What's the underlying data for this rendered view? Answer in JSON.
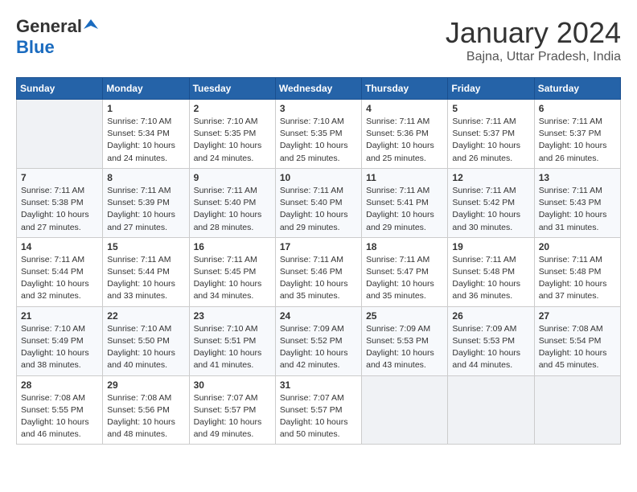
{
  "header": {
    "logo_general": "General",
    "logo_blue": "Blue",
    "month_year": "January 2024",
    "location": "Bajna, Uttar Pradesh, India"
  },
  "calendar": {
    "days_of_week": [
      "Sunday",
      "Monday",
      "Tuesday",
      "Wednesday",
      "Thursday",
      "Friday",
      "Saturday"
    ],
    "weeks": [
      [
        {
          "day": "",
          "info": ""
        },
        {
          "day": "1",
          "info": "Sunrise: 7:10 AM\nSunset: 5:34 PM\nDaylight: 10 hours\nand 24 minutes."
        },
        {
          "day": "2",
          "info": "Sunrise: 7:10 AM\nSunset: 5:35 PM\nDaylight: 10 hours\nand 24 minutes."
        },
        {
          "day": "3",
          "info": "Sunrise: 7:10 AM\nSunset: 5:35 PM\nDaylight: 10 hours\nand 25 minutes."
        },
        {
          "day": "4",
          "info": "Sunrise: 7:11 AM\nSunset: 5:36 PM\nDaylight: 10 hours\nand 25 minutes."
        },
        {
          "day": "5",
          "info": "Sunrise: 7:11 AM\nSunset: 5:37 PM\nDaylight: 10 hours\nand 26 minutes."
        },
        {
          "day": "6",
          "info": "Sunrise: 7:11 AM\nSunset: 5:37 PM\nDaylight: 10 hours\nand 26 minutes."
        }
      ],
      [
        {
          "day": "7",
          "info": "Sunrise: 7:11 AM\nSunset: 5:38 PM\nDaylight: 10 hours\nand 27 minutes."
        },
        {
          "day": "8",
          "info": "Sunrise: 7:11 AM\nSunset: 5:39 PM\nDaylight: 10 hours\nand 27 minutes."
        },
        {
          "day": "9",
          "info": "Sunrise: 7:11 AM\nSunset: 5:40 PM\nDaylight: 10 hours\nand 28 minutes."
        },
        {
          "day": "10",
          "info": "Sunrise: 7:11 AM\nSunset: 5:40 PM\nDaylight: 10 hours\nand 29 minutes."
        },
        {
          "day": "11",
          "info": "Sunrise: 7:11 AM\nSunset: 5:41 PM\nDaylight: 10 hours\nand 29 minutes."
        },
        {
          "day": "12",
          "info": "Sunrise: 7:11 AM\nSunset: 5:42 PM\nDaylight: 10 hours\nand 30 minutes."
        },
        {
          "day": "13",
          "info": "Sunrise: 7:11 AM\nSunset: 5:43 PM\nDaylight: 10 hours\nand 31 minutes."
        }
      ],
      [
        {
          "day": "14",
          "info": "Sunrise: 7:11 AM\nSunset: 5:44 PM\nDaylight: 10 hours\nand 32 minutes."
        },
        {
          "day": "15",
          "info": "Sunrise: 7:11 AM\nSunset: 5:44 PM\nDaylight: 10 hours\nand 33 minutes."
        },
        {
          "day": "16",
          "info": "Sunrise: 7:11 AM\nSunset: 5:45 PM\nDaylight: 10 hours\nand 34 minutes."
        },
        {
          "day": "17",
          "info": "Sunrise: 7:11 AM\nSunset: 5:46 PM\nDaylight: 10 hours\nand 35 minutes."
        },
        {
          "day": "18",
          "info": "Sunrise: 7:11 AM\nSunset: 5:47 PM\nDaylight: 10 hours\nand 35 minutes."
        },
        {
          "day": "19",
          "info": "Sunrise: 7:11 AM\nSunset: 5:48 PM\nDaylight: 10 hours\nand 36 minutes."
        },
        {
          "day": "20",
          "info": "Sunrise: 7:11 AM\nSunset: 5:48 PM\nDaylight: 10 hours\nand 37 minutes."
        }
      ],
      [
        {
          "day": "21",
          "info": "Sunrise: 7:10 AM\nSunset: 5:49 PM\nDaylight: 10 hours\nand 38 minutes."
        },
        {
          "day": "22",
          "info": "Sunrise: 7:10 AM\nSunset: 5:50 PM\nDaylight: 10 hours\nand 40 minutes."
        },
        {
          "day": "23",
          "info": "Sunrise: 7:10 AM\nSunset: 5:51 PM\nDaylight: 10 hours\nand 41 minutes."
        },
        {
          "day": "24",
          "info": "Sunrise: 7:09 AM\nSunset: 5:52 PM\nDaylight: 10 hours\nand 42 minutes."
        },
        {
          "day": "25",
          "info": "Sunrise: 7:09 AM\nSunset: 5:53 PM\nDaylight: 10 hours\nand 43 minutes."
        },
        {
          "day": "26",
          "info": "Sunrise: 7:09 AM\nSunset: 5:53 PM\nDaylight: 10 hours\nand 44 minutes."
        },
        {
          "day": "27",
          "info": "Sunrise: 7:08 AM\nSunset: 5:54 PM\nDaylight: 10 hours\nand 45 minutes."
        }
      ],
      [
        {
          "day": "28",
          "info": "Sunrise: 7:08 AM\nSunset: 5:55 PM\nDaylight: 10 hours\nand 46 minutes."
        },
        {
          "day": "29",
          "info": "Sunrise: 7:08 AM\nSunset: 5:56 PM\nDaylight: 10 hours\nand 48 minutes."
        },
        {
          "day": "30",
          "info": "Sunrise: 7:07 AM\nSunset: 5:57 PM\nDaylight: 10 hours\nand 49 minutes."
        },
        {
          "day": "31",
          "info": "Sunrise: 7:07 AM\nSunset: 5:57 PM\nDaylight: 10 hours\nand 50 minutes."
        },
        {
          "day": "",
          "info": ""
        },
        {
          "day": "",
          "info": ""
        },
        {
          "day": "",
          "info": ""
        }
      ]
    ]
  }
}
